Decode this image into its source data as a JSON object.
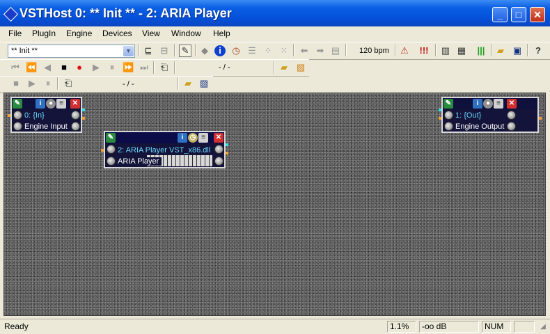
{
  "window": {
    "title": "VSTHost 0: ** Init ** - 2: ARIA Player"
  },
  "menubar": {
    "items": [
      "File",
      "PlugIn",
      "Engine",
      "Devices",
      "View",
      "Window",
      "Help"
    ]
  },
  "toolbar1": {
    "program_select": "** Init **",
    "tempo": "120 bpm"
  },
  "toolbar2": {
    "position": "- / -"
  },
  "toolbar3": {
    "position": "- / -"
  },
  "modules": {
    "engine_input": {
      "name": "0: {In}",
      "label": "Engine Input"
    },
    "aria_player": {
      "name": "2: ARIA Player VST_x86.dll",
      "label": "ARIA Player"
    },
    "engine_output": {
      "name": "1: {Out}",
      "label": "Engine Output"
    }
  },
  "statusbar": {
    "status": "Ready",
    "cpu": "1.1%",
    "level": "-oo dB",
    "num": "NUM"
  },
  "colors": {
    "title_blue": "#0550d8",
    "workspace_gray": "#5c5c5c",
    "module_bg": "#14143a",
    "module_text": "#6ad8ff"
  }
}
